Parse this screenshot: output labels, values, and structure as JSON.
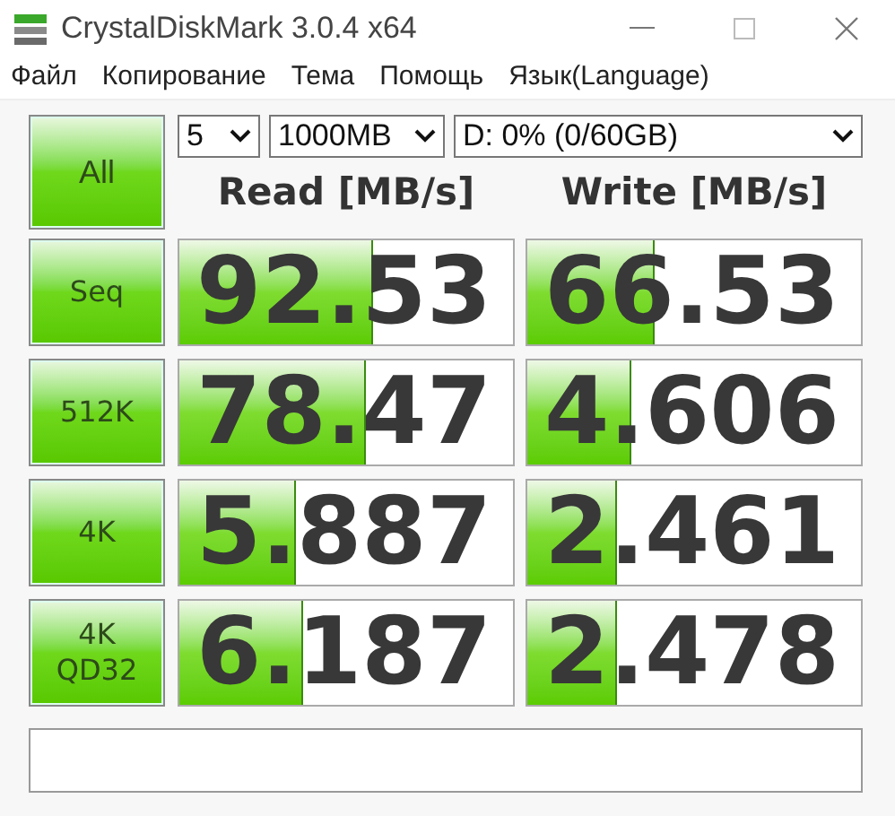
{
  "window": {
    "title": "CrystalDiskMark 3.0.4 x64"
  },
  "menu": [
    "Файл",
    "Копирование",
    "Тема",
    "Помощь",
    "Язык(Language)"
  ],
  "all_button": "All",
  "test_count": "5",
  "test_size": "1000MB",
  "drive": "D: 0% (0/60GB)",
  "columns": [
    "Read [MB/s]",
    "Write [MB/s]"
  ],
  "rows": [
    {
      "label": "Seq",
      "read": {
        "value": "92.53",
        "level": 0.58
      },
      "write": {
        "value": "66.53",
        "level": 0.38
      }
    },
    {
      "label": "512K",
      "read": {
        "value": "78.47",
        "level": 0.56
      },
      "write": {
        "value": "4.606",
        "level": 0.31
      }
    },
    {
      "label": "4K",
      "read": {
        "value": "5.887",
        "level": 0.35
      },
      "write": {
        "value": "2.461",
        "level": 0.27
      }
    },
    {
      "label": "4K\nQD32",
      "read": {
        "value": "6.187",
        "level": 0.37
      },
      "write": {
        "value": "2.478",
        "level": 0.27
      }
    }
  ]
}
